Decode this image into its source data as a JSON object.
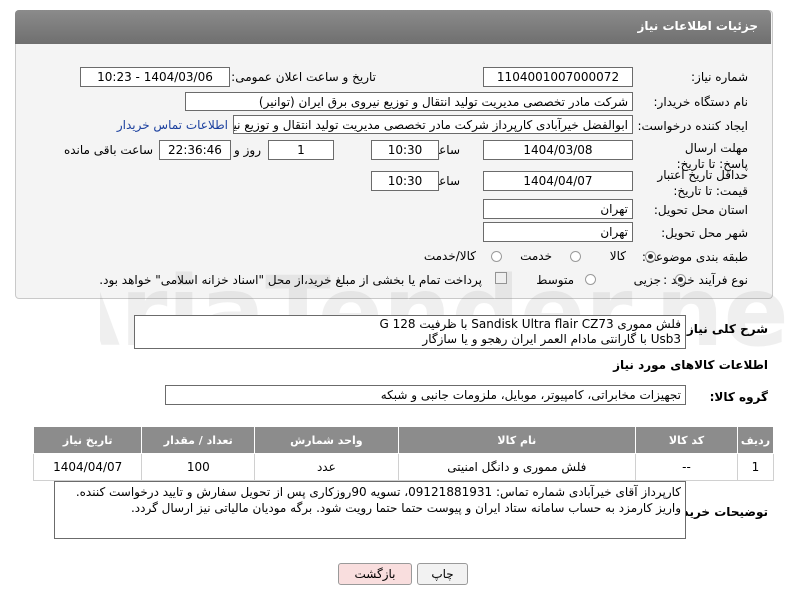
{
  "panel_title": "جزئیات اطلاعات نیاز",
  "fields": {
    "need_number_label": "شماره نیاز:",
    "need_number": "1104001007000072",
    "announce_label": "تاریخ و ساعت اعلان عمومی:",
    "announce_value": "1404/03/06 - 10:23",
    "buyer_org_label": "نام دستگاه خریدار:",
    "buyer_org": "شرکت مادر تخصصی مدیریت تولید  انتقال و توزیع نیروی برق ایران (توانیر)",
    "creator_label": "ایجاد کننده درخواست:",
    "creator": "ابوالفضل خیرآبادی کارپرداز شرکت مادر تخصصی مدیریت تولید  انتقال و توزیع نیروی برق ایران (توانیر)",
    "contact_link": "اطلاعات تماس خریدار",
    "reply_deadline_label": "مهلت ارسال پاسخ: تا تاریخ:",
    "reply_date": "1404/03/08",
    "time_label": "ساعت",
    "reply_time": "10:30",
    "days_value": "1",
    "days_label": "روز و",
    "remaining_time": "22:36:46",
    "remaining_label": "ساعت باقی مانده",
    "price_validity_label": "حداقل تاریخ اعتبار قیمت: تا تاریخ:",
    "price_date": "1404/04/07",
    "price_time": "10:30",
    "province_label": "استان محل تحویل:",
    "province": "تهران",
    "city_label": "شهر محل تحویل:",
    "city": "تهران",
    "category_label": "طبقه بندی موضوعی:",
    "category_options": [
      "کالا",
      "خدمت",
      "کالا/خدمت"
    ],
    "category_selected": "کالا",
    "process_label": "نوع فرآیند خرید :",
    "process_options": [
      "جزیی",
      "متوسط"
    ],
    "process_selected": "جزیی",
    "payment_note": "پرداخت تمام یا بخشی از مبلغ خرید،از محل \"اسناد خزانه اسلامی\" خواهد بود."
  },
  "description": {
    "label": "شرح کلی نیاز:",
    "line1": "فلش مموری Sandisk Ultra flair CZ73  با ظرفیت 128 G",
    "line2": "Usb3  با گارانتی مادام  العمر ایران رهجو و یا سازگار"
  },
  "goods_info_title": "اطلاعات کالاهای مورد نیاز",
  "goods_group": {
    "label": "گروه کالا:",
    "value": "تجهیزات مخابراتی، کامپیوتر، موبایل، ملزومات جانبی و شبکه"
  },
  "table": {
    "headers": [
      "ردیف",
      "کد کالا",
      "نام کالا",
      "واحد شمارش",
      "تعداد / مقدار",
      "تاریخ نیاز"
    ],
    "rows": [
      [
        "1",
        "--",
        "فلش مموری و دانگل امنیتی",
        "عدد",
        "100",
        "1404/04/07"
      ]
    ]
  },
  "buyer_notes": {
    "label": "توضیحات خریدار:",
    "text": "کارپرداز آقای خیرآبادی شماره تماس: 09121881931، تسویه 90روزکاری پس از تحویل سفارش و تایید درخواست کننده. واریز کارمزد به حساب سامانه ستاد ایران و پیوست حتما حتما رویت شود. برگه مودیان مالیاتی نیز ارسال گردد."
  },
  "buttons": {
    "print": "چاپ",
    "back": "بازگشت"
  },
  "watermark_text": "AriaTender.neT",
  "colors": {
    "header_bg": "#7d7d7d",
    "table_header_bg": "#8c8c8c",
    "link": "#1a3f9e",
    "back_button_bg": "#f9dede"
  }
}
